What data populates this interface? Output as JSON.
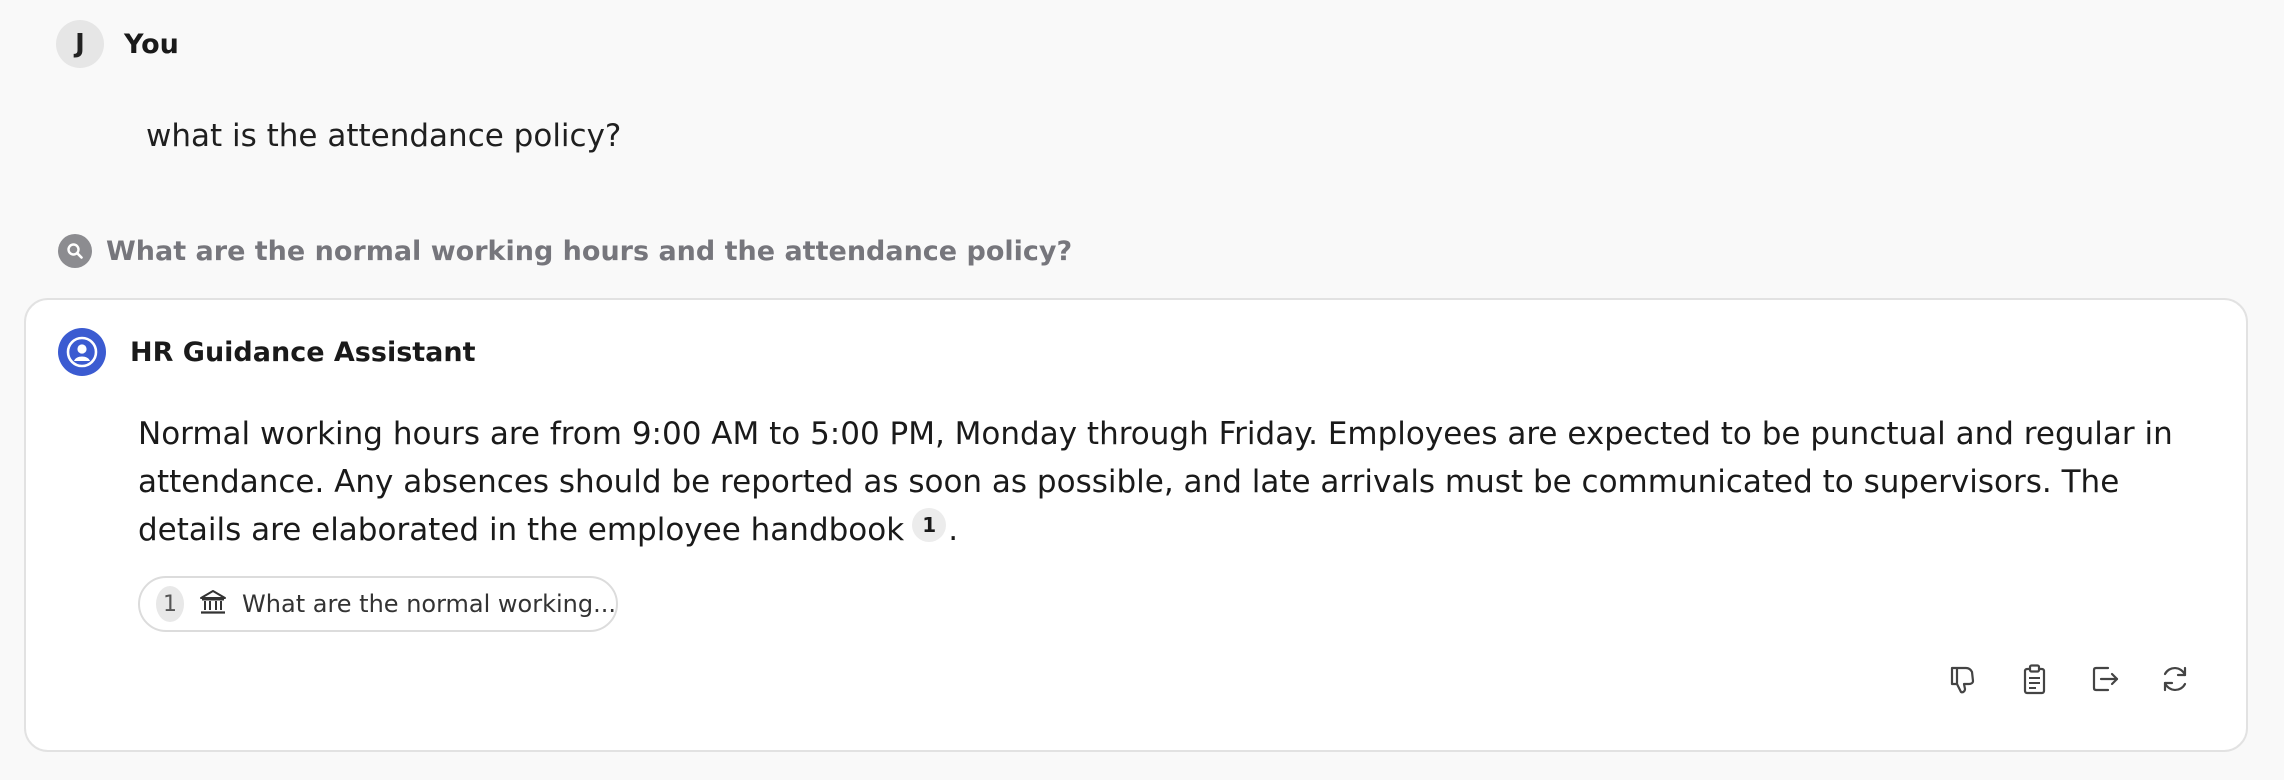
{
  "user": {
    "avatar_initial": "J",
    "name": "You",
    "message": "what is the attendance policy?"
  },
  "search": {
    "icon": "search-icon",
    "query": "What are the normal working hours and the attendance policy?"
  },
  "assistant": {
    "icon": "user-circle-icon",
    "name": "HR Guidance Assistant",
    "answer_text": "Normal working hours are from 9:00 AM to 5:00 PM, Monday through Friday. Employees are expected to be punctual and regular in attendance. Any absences should be reported as soon as possible, and late arrivals must be communicated to supervisors. The details are elaborated in the employee handbook",
    "citation_number": "1",
    "answer_end": ".",
    "sources": [
      {
        "number": "1",
        "icon": "bank-icon",
        "label": "What are the normal working..."
      }
    ],
    "actions": [
      "thumbs-down-icon",
      "clipboard-icon",
      "export-icon",
      "refresh-icon"
    ]
  },
  "colors": {
    "background": "#f9f9f9",
    "card": "#ffffff",
    "assistant_avatar": "#3b5bd1",
    "muted_text": "#76767c"
  }
}
